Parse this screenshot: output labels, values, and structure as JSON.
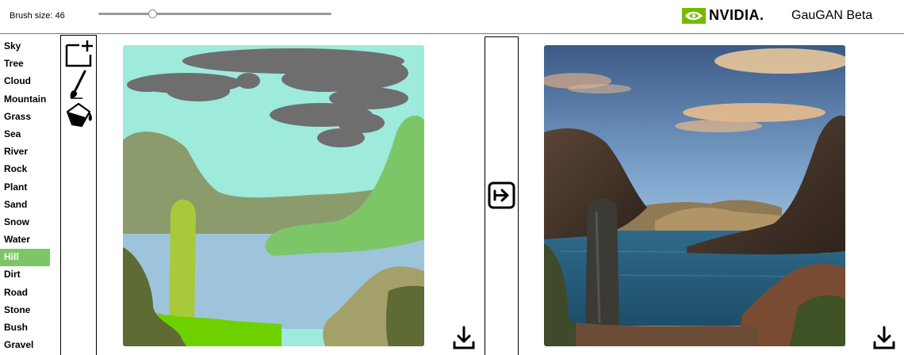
{
  "header": {
    "brush_label": "Brush size: 46",
    "brush_size": 46,
    "brush_max": 200,
    "brand": "NVIDIA.",
    "product": "GauGAN Beta"
  },
  "labels": {
    "items": [
      "Sky",
      "Tree",
      "Cloud",
      "Mountain",
      "Grass",
      "Sea",
      "River",
      "Rock",
      "Plant",
      "Sand",
      "Snow",
      "Water",
      "Hill",
      "Dirt",
      "Road",
      "Stone",
      "Bush",
      "Gravel"
    ],
    "selected": "Hill"
  },
  "tools": {
    "items": [
      "new-canvas-icon",
      "brush-icon",
      "fill-bucket-icon"
    ]
  },
  "colors": {
    "selected_label": "#7dc667",
    "nvidia_green": "#76b900",
    "sky": "#9eeadb",
    "cloud": "#6e6e6e",
    "mountain": "#8c9b6c",
    "hill": "#7dc667",
    "water": "#9ec4dc",
    "tree": "#a8c93a",
    "grass": "#6fd000",
    "bush": "#5e6b34",
    "dirt": "#a4a06a"
  },
  "actions": {
    "run": "arrow-right-box-icon",
    "download_left": "download-icon",
    "download_right": "download-icon"
  }
}
